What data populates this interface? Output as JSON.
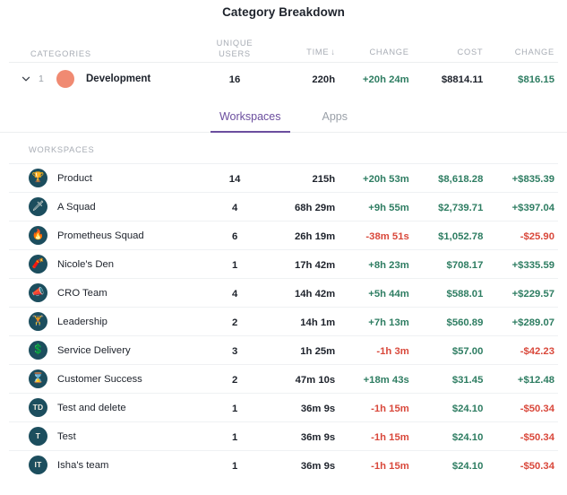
{
  "title": "Category Breakdown",
  "table": {
    "headers": {
      "categories": "CATEGORIES",
      "unique_users_line1": "UNIQUE",
      "unique_users_line2": "USERS",
      "time": "TIME",
      "time_sort_icon": "arrow-down-icon",
      "change_time": "CHANGE",
      "cost": "COST",
      "change_cost": "CHANGE"
    },
    "category_row": {
      "expand_icon": "chevron-down-icon",
      "rank": "1",
      "color_dot": "#f08a72",
      "name": "Development",
      "unique_users": "16",
      "time": "220h",
      "time_change": "+20h 24m",
      "time_change_sign": "positive",
      "cost": "$8814.11",
      "cost_change": "$816.15",
      "cost_change_sign": "positive"
    }
  },
  "tabs": {
    "items": [
      {
        "label": "Workspaces",
        "active": true
      },
      {
        "label": "Apps",
        "active": false
      }
    ],
    "active_color": "#6b4e9e"
  },
  "workspaces": {
    "section_label": "WORKSPACES",
    "rows": [
      {
        "avatar_type": "emoji",
        "avatar": "🏆",
        "avatar_name": "trophy-icon",
        "name": "Product",
        "unique_users": "14",
        "time": "215h",
        "time_change": "+20h 53m",
        "time_change_sign": "positive",
        "cost": "$8,618.28",
        "cost_change": "+$835.39",
        "cost_change_sign": "positive"
      },
      {
        "avatar_type": "emoji",
        "avatar": "🗡",
        "avatar_name": "dagger-icon",
        "name": "A Squad",
        "unique_users": "4",
        "time": "68h 29m",
        "time_change": "+9h 55m",
        "time_change_sign": "positive",
        "cost": "$2,739.71",
        "cost_change": "+$397.04",
        "cost_change_sign": "positive"
      },
      {
        "avatar_type": "emoji",
        "avatar": "🔥",
        "avatar_name": "fire-icon",
        "name": "Prometheus Squad",
        "unique_users": "6",
        "time": "26h 19m",
        "time_change": "-38m 51s",
        "time_change_sign": "negative",
        "cost": "$1,052.78",
        "cost_change": "-$25.90",
        "cost_change_sign": "negative"
      },
      {
        "avatar_type": "emoji",
        "avatar": "🧨",
        "avatar_name": "firecracker-icon",
        "name": "Nicole's Den",
        "unique_users": "1",
        "time": "17h 42m",
        "time_change": "+8h 23m",
        "time_change_sign": "positive",
        "cost": "$708.17",
        "cost_change": "+$335.59",
        "cost_change_sign": "positive"
      },
      {
        "avatar_type": "emoji",
        "avatar": "📣",
        "avatar_name": "megaphone-icon",
        "name": "CRO Team",
        "unique_users": "4",
        "time": "14h 42m",
        "time_change": "+5h 44m",
        "time_change_sign": "positive",
        "cost": "$588.01",
        "cost_change": "+$229.57",
        "cost_change_sign": "positive"
      },
      {
        "avatar_type": "emoji",
        "avatar": "🏋",
        "avatar_name": "weightlifter-icon",
        "name": "Leadership",
        "unique_users": "2",
        "time": "14h 1m",
        "time_change": "+7h 13m",
        "time_change_sign": "positive",
        "cost": "$560.89",
        "cost_change": "+$289.07",
        "cost_change_sign": "positive"
      },
      {
        "avatar_type": "emoji",
        "avatar": "💲",
        "avatar_name": "dollar-sign-icon",
        "name": "Service Delivery",
        "unique_users": "3",
        "time": "1h 25m",
        "time_change": "-1h 3m",
        "time_change_sign": "negative",
        "cost": "$57.00",
        "cost_change": "-$42.23",
        "cost_change_sign": "negative"
      },
      {
        "avatar_type": "emoji",
        "avatar": "⌛",
        "avatar_name": "hourglass-icon",
        "name": "Customer Success",
        "unique_users": "2",
        "time": "47m 10s",
        "time_change": "+18m 43s",
        "time_change_sign": "positive",
        "cost": "$31.45",
        "cost_change": "+$12.48",
        "cost_change_sign": "positive"
      },
      {
        "avatar_type": "initials",
        "avatar": "TD",
        "avatar_name": "initials-avatar",
        "name": "Test and delete",
        "unique_users": "1",
        "time": "36m 9s",
        "time_change": "-1h 15m",
        "time_change_sign": "negative",
        "cost": "$24.10",
        "cost_change": "-$50.34",
        "cost_change_sign": "negative"
      },
      {
        "avatar_type": "initials",
        "avatar": "T",
        "avatar_name": "initials-avatar",
        "name": "Test",
        "unique_users": "1",
        "time": "36m 9s",
        "time_change": "-1h 15m",
        "time_change_sign": "negative",
        "cost": "$24.10",
        "cost_change": "-$50.34",
        "cost_change_sign": "negative"
      },
      {
        "avatar_type": "initials",
        "avatar": "IT",
        "avatar_name": "initials-avatar",
        "name": "Isha's team",
        "unique_users": "1",
        "time": "36m 9s",
        "time_change": "-1h 15m",
        "time_change_sign": "negative",
        "cost": "$24.10",
        "cost_change": "-$50.34",
        "cost_change_sign": "negative"
      }
    ]
  },
  "colors": {
    "positive": "#2e7d62",
    "negative": "#d9483b",
    "accent_purple": "#6b4e9e",
    "avatar_bg": "#1c4e5e",
    "category_dot": "#f08a72"
  }
}
